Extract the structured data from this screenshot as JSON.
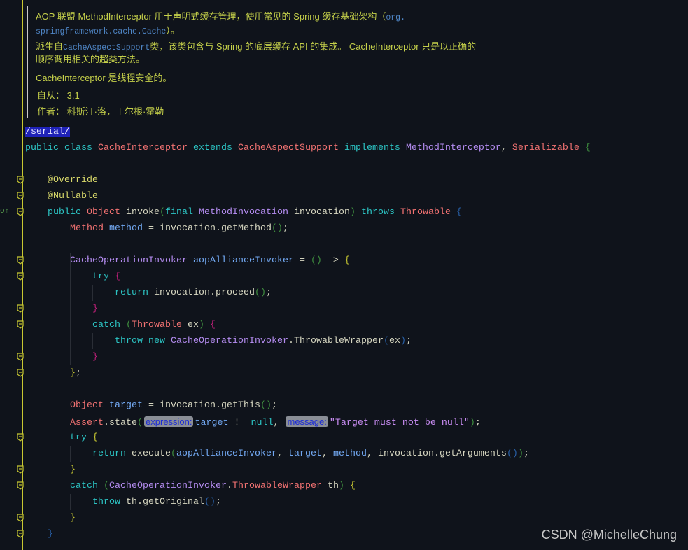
{
  "doc": {
    "p1_text": "AOP 联盟 MethodInterceptor 用于声明式缓存管理，使用常见的 Spring 缓存基础架构（",
    "p1_code": "org.",
    "p1_code2": "springframework.cache.Cache",
    "p1_end": "）。",
    "p2_start": "派生自",
    "p2_code": "CacheAspectSupport",
    "p2_rest": "类，该类包含与 Spring 的底层缓存 API 的集成。 CacheInterceptor 只是以正确的",
    "p2_line2": "顺序调用相关的超类方法。",
    "p3": "CacheInterceptor 是线程安全的。",
    "since_label": "自从：",
    "since_value": "3.1",
    "author_label": "作者：",
    "author_value": "科斯汀·洛，于尔根·霍勒"
  },
  "code": [
    {
      "indent": 0,
      "tokens": [
        [
          "/serial/",
          "hl"
        ]
      ]
    },
    {
      "indent": 0,
      "tokens": [
        [
          "public ",
          "kw"
        ],
        [
          "class ",
          "kw"
        ],
        [
          "CacheInterceptor ",
          "cls"
        ],
        [
          "extends ",
          "kw"
        ],
        [
          "CacheAspectSupport ",
          "cls"
        ],
        [
          "implements ",
          "kw"
        ],
        [
          "MethodInterceptor",
          "itf"
        ],
        [
          ", ",
          "txt"
        ],
        [
          "Serializable ",
          "cls"
        ],
        [
          "{",
          "pg"
        ]
      ]
    },
    {
      "indent": 0,
      "tokens": []
    },
    {
      "indent": 1,
      "fold": true,
      "tokens": [
        [
          "@Override",
          "ann"
        ]
      ]
    },
    {
      "indent": 1,
      "fold": true,
      "tokens": [
        [
          "@Nullable",
          "ann"
        ]
      ]
    },
    {
      "indent": 1,
      "fold": true,
      "tokens": [
        [
          "public ",
          "kw"
        ],
        [
          "Object ",
          "cls"
        ],
        [
          "invoke",
          "txt"
        ],
        [
          "(",
          "pg"
        ],
        [
          "final ",
          "kw"
        ],
        [
          "MethodInvocation ",
          "itf"
        ],
        [
          "invocation",
          "txt"
        ],
        [
          ")",
          "pg"
        ],
        [
          " throws ",
          "kw"
        ],
        [
          "Throwable ",
          "cls"
        ],
        [
          "{",
          "pb"
        ]
      ]
    },
    {
      "indent": 2,
      "tokens": [
        [
          "Method ",
          "cls"
        ],
        [
          "method ",
          "var"
        ],
        [
          "= invocation.getMethod",
          "txt"
        ],
        [
          "()",
          "pg"
        ],
        [
          ";",
          "txt"
        ]
      ]
    },
    {
      "indent": 2,
      "tokens": []
    },
    {
      "indent": 2,
      "fold": true,
      "tokens": [
        [
          "CacheOperationInvoker ",
          "itf"
        ],
        [
          "aopAllianceInvoker ",
          "var"
        ],
        [
          "= ",
          "txt"
        ],
        [
          "()",
          "pg"
        ],
        [
          " -> ",
          "txt"
        ],
        [
          "{",
          "py"
        ]
      ]
    },
    {
      "indent": 3,
      "fold": true,
      "tokens": [
        [
          "try ",
          "kw"
        ],
        [
          "{",
          "pp"
        ]
      ]
    },
    {
      "indent": 4,
      "tokens": [
        [
          "return ",
          "kw"
        ],
        [
          "invocation.proceed",
          "txt"
        ],
        [
          "()",
          "pg"
        ],
        [
          ";",
          "txt"
        ]
      ]
    },
    {
      "indent": 3,
      "fold": true,
      "tokens": [
        [
          "}",
          "pp"
        ]
      ]
    },
    {
      "indent": 3,
      "fold": true,
      "tokens": [
        [
          "catch ",
          "kw"
        ],
        [
          "(",
          "pg"
        ],
        [
          "Throwable ",
          "cls"
        ],
        [
          "ex",
          "txt"
        ],
        [
          ") ",
          "pg"
        ],
        [
          "{",
          "pp"
        ]
      ]
    },
    {
      "indent": 4,
      "tokens": [
        [
          "throw ",
          "kw"
        ],
        [
          "new ",
          "kw"
        ],
        [
          "CacheOperationInvoker",
          "itf"
        ],
        [
          ".ThrowableWrapper",
          "txt"
        ],
        [
          "(",
          "pb"
        ],
        [
          "ex",
          "txt"
        ],
        [
          ")",
          "pb"
        ],
        [
          ";",
          "txt"
        ]
      ]
    },
    {
      "indent": 3,
      "fold": true,
      "tokens": [
        [
          "}",
          "pp"
        ]
      ]
    },
    {
      "indent": 2,
      "fold": true,
      "tokens": [
        [
          "}",
          "py"
        ],
        [
          ";",
          "txt"
        ]
      ]
    },
    {
      "indent": 2,
      "tokens": []
    },
    {
      "indent": 2,
      "tokens": [
        [
          "Object ",
          "cls"
        ],
        [
          "target ",
          "var"
        ],
        [
          "= invocation.getThis",
          "txt"
        ],
        [
          "()",
          "pg"
        ],
        [
          ";",
          "txt"
        ]
      ]
    },
    {
      "indent": 2,
      "tokens": [
        [
          "Assert",
          "cls"
        ],
        [
          ".state",
          "txt"
        ],
        [
          "(",
          "pg"
        ],
        [
          "expression:",
          "hint"
        ],
        [
          "target ",
          "var"
        ],
        [
          "!= ",
          "txt"
        ],
        [
          "null",
          "kw"
        ],
        [
          ", ",
          "txt"
        ],
        [
          "message:",
          "hint"
        ],
        [
          "\"Target must not be null\"",
          "str"
        ],
        [
          ")",
          "pg"
        ],
        [
          ";",
          "txt"
        ]
      ]
    },
    {
      "indent": 2,
      "fold": true,
      "tokens": [
        [
          "try ",
          "kw"
        ],
        [
          "{",
          "py"
        ]
      ]
    },
    {
      "indent": 3,
      "tokens": [
        [
          "return ",
          "kw"
        ],
        [
          "execute",
          "txt"
        ],
        [
          "(",
          "pg"
        ],
        [
          "aopAllianceInvoker",
          "var"
        ],
        [
          ", ",
          "txt"
        ],
        [
          "target",
          "var"
        ],
        [
          ", ",
          "txt"
        ],
        [
          "method",
          "var"
        ],
        [
          ", invocation.getArguments",
          "txt"
        ],
        [
          "()",
          "pb"
        ],
        [
          ")",
          "pg"
        ],
        [
          ";",
          "txt"
        ]
      ]
    },
    {
      "indent": 2,
      "fold": true,
      "tokens": [
        [
          "}",
          "py"
        ]
      ]
    },
    {
      "indent": 2,
      "fold": true,
      "tokens": [
        [
          "catch ",
          "kw"
        ],
        [
          "(",
          "pg"
        ],
        [
          "CacheOperationInvoker",
          "itf"
        ],
        [
          ".",
          "txt"
        ],
        [
          "ThrowableWrapper ",
          "cls"
        ],
        [
          "th",
          "txt"
        ],
        [
          ") ",
          "pg"
        ],
        [
          "{",
          "py"
        ]
      ]
    },
    {
      "indent": 3,
      "tokens": [
        [
          "throw ",
          "kw"
        ],
        [
          "th.getOriginal",
          "txt"
        ],
        [
          "()",
          "pb"
        ],
        [
          ";",
          "txt"
        ]
      ]
    },
    {
      "indent": 2,
      "fold": true,
      "tokens": [
        [
          "}",
          "py"
        ]
      ]
    },
    {
      "indent": 1,
      "fold": true,
      "tokens": [
        [
          "}",
          "pb"
        ]
      ]
    }
  ],
  "watermark": "CSDN @MichelleChung",
  "colors": {
    "background": "#0f131b",
    "fold_marker": "#c8c832",
    "doc_text": "#c5d04a"
  }
}
